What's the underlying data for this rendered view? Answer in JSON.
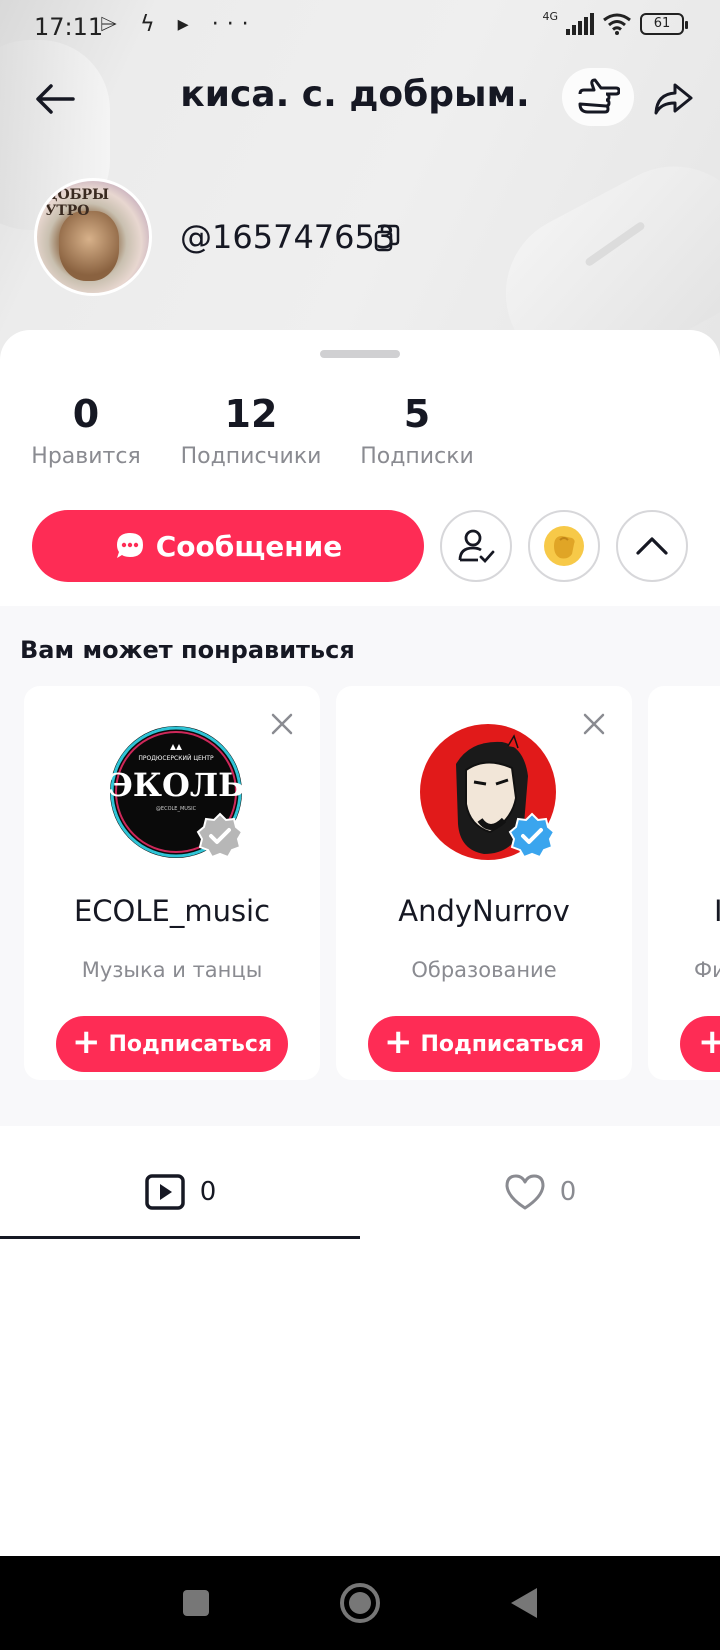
{
  "status_bar": {
    "time": "17:11",
    "left_icons": "⌲ ϟ ▸ ···",
    "network": "4G",
    "battery": "61"
  },
  "header": {
    "title": "киса. с. добрым.",
    "back_icon": "arrow-left-icon",
    "poke_icon": "pointing-hand-icon",
    "share_icon": "share-arrow-icon"
  },
  "profile": {
    "handle": "@165747653",
    "avatar_caption": "ДОБРЫ УТРО"
  },
  "stats": [
    {
      "value": "0",
      "label": "Нравится"
    },
    {
      "value": "12",
      "label": "Подписчики"
    },
    {
      "value": "5",
      "label": "Подписки"
    }
  ],
  "actions": {
    "message_label": "Сообщение"
  },
  "suggestions": {
    "title": "Вам может понравиться",
    "cards": [
      {
        "name": "ECOLE_music",
        "category": "Музыка и танцы",
        "follow_label": "Подписаться",
        "avatar_text": "ЭКОЛЬ",
        "avatar_subtext": "ПРОДЮСЕРСКИЙ ЦЕНТР",
        "avatar_tag": "@ECOLE_MUSIC"
      },
      {
        "name": "AndyNurrov",
        "category": "Образование",
        "follow_label": "Подписаться"
      },
      {
        "name": "I",
        "category": "Фи",
        "follow_label": ""
      }
    ]
  },
  "tabs": [
    {
      "icon": "video-play-icon",
      "count": "0"
    },
    {
      "icon": "heart-icon",
      "count": "0"
    }
  ],
  "colors": {
    "accent": "#fe2c55",
    "text": "#161823",
    "muted": "#8a8b91"
  }
}
